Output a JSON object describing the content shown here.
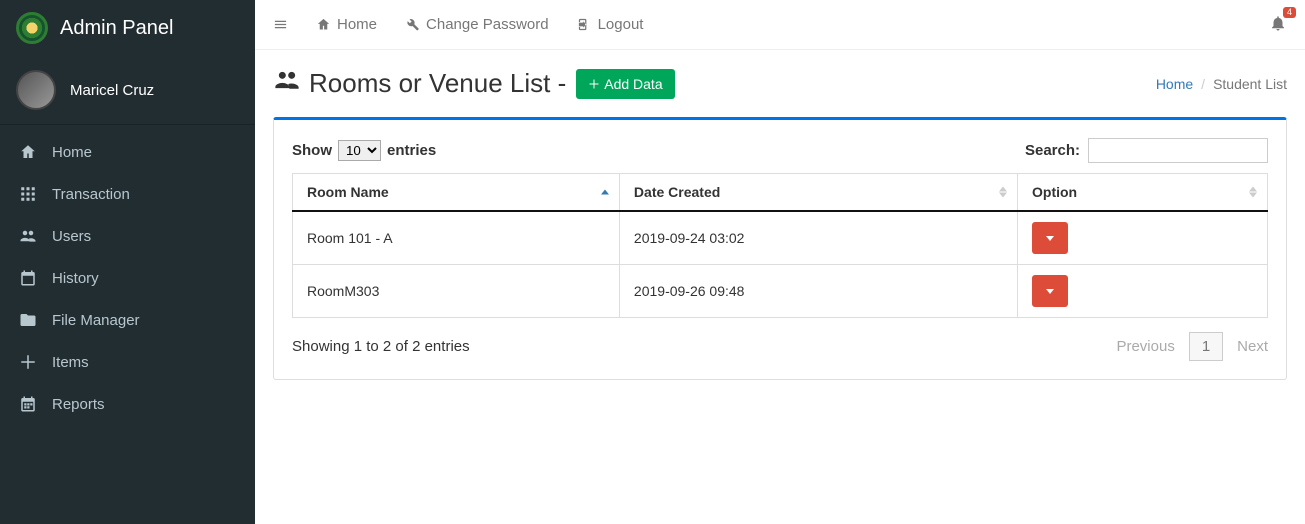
{
  "brand": {
    "title": "Admin Panel"
  },
  "user": {
    "name": "Maricel Cruz"
  },
  "sidebar": {
    "items": [
      {
        "label": "Home"
      },
      {
        "label": "Transaction"
      },
      {
        "label": "Users"
      },
      {
        "label": "History"
      },
      {
        "label": "File Manager"
      },
      {
        "label": "Items"
      },
      {
        "label": "Reports"
      }
    ]
  },
  "topbar": {
    "home": "Home",
    "change_password": "Change Password",
    "logout": "Logout",
    "notification_count": "4"
  },
  "page": {
    "title": "Rooms or Venue List - ",
    "add_button": "Add Data"
  },
  "breadcrumb": {
    "home": "Home",
    "current": "Student List"
  },
  "table": {
    "show_label": "Show",
    "entries_label": "entries",
    "page_size": "10",
    "search_label": "Search:",
    "search_value": "",
    "columns": {
      "room_name": "Room Name",
      "date_created": "Date Created",
      "option": "Option"
    },
    "rows": [
      {
        "room_name": "Room 101 - A",
        "date_created": "2019-09-24 03:02"
      },
      {
        "room_name": "RoomM303",
        "date_created": "2019-09-26 09:48"
      }
    ],
    "info": "Showing 1 to 2 of 2 entries",
    "pagination": {
      "previous": "Previous",
      "next": "Next",
      "current": "1"
    }
  }
}
